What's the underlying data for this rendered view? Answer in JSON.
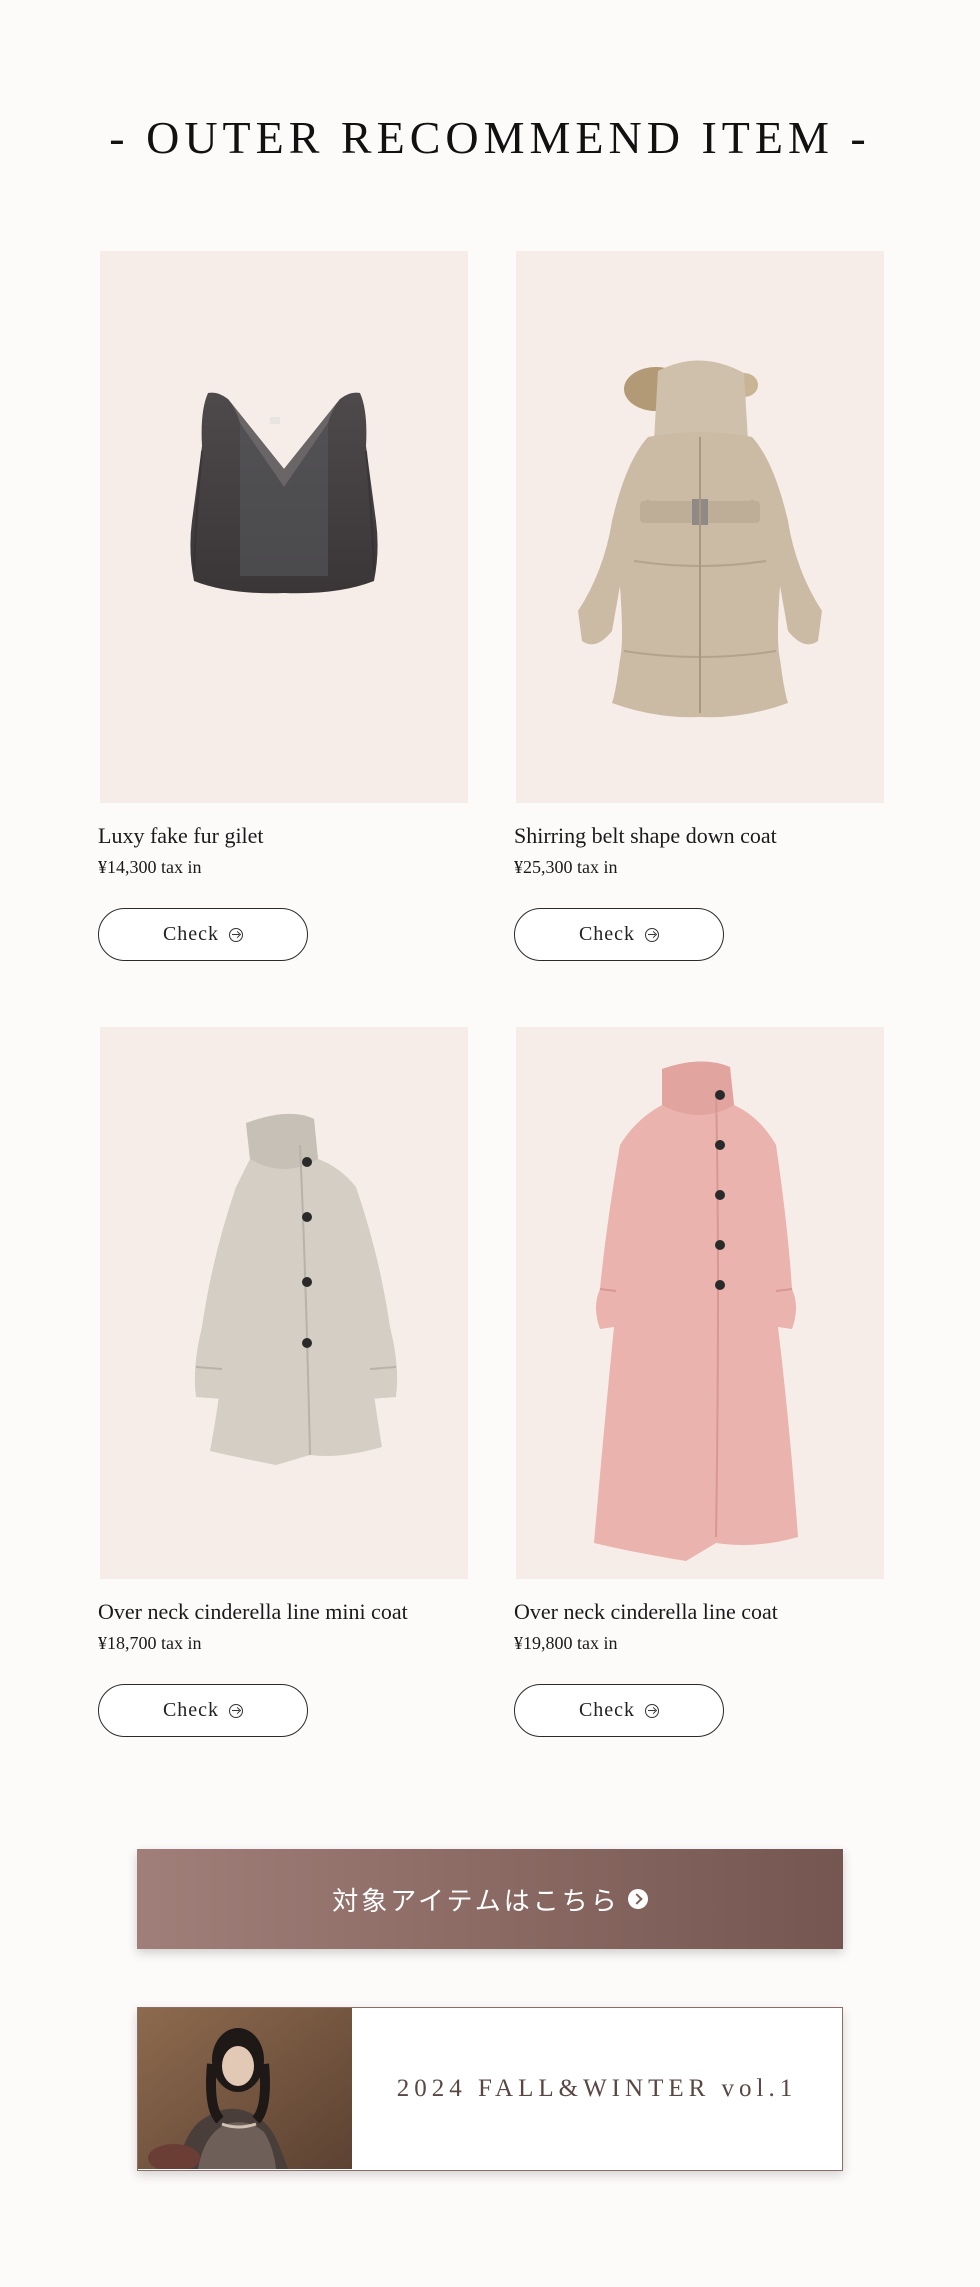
{
  "section": {
    "title": "- OUTER RECOMMEND ITEM -"
  },
  "products": [
    {
      "name": "Luxy fake fur gilet",
      "price": "¥14,300 tax in",
      "check_label": "Check",
      "image_icon": "fur-gilet-icon"
    },
    {
      "name": "Shirring belt shape down coat",
      "price": "¥25,300 tax in",
      "check_label": "Check",
      "image_icon": "down-coat-icon"
    },
    {
      "name": "Over neck cinderella line mini coat",
      "price": "¥18,700 tax in",
      "check_label": "Check",
      "image_icon": "mini-coat-icon"
    },
    {
      "name": "Over neck cinderella line coat",
      "price": "¥19,800 tax in",
      "check_label": "Check",
      "image_icon": "long-coat-icon"
    }
  ],
  "cta": {
    "label": "対象アイテムはこちら"
  },
  "lookbook": {
    "label": "2024 FALL&WINTER vol.1"
  },
  "colors": {
    "page_background": "#fdfafa",
    "photo_background": "#f6ede8",
    "cta_gradient_start": "#a07e79",
    "cta_gradient_end": "#755650",
    "lookbook_text": "#5a4744"
  }
}
